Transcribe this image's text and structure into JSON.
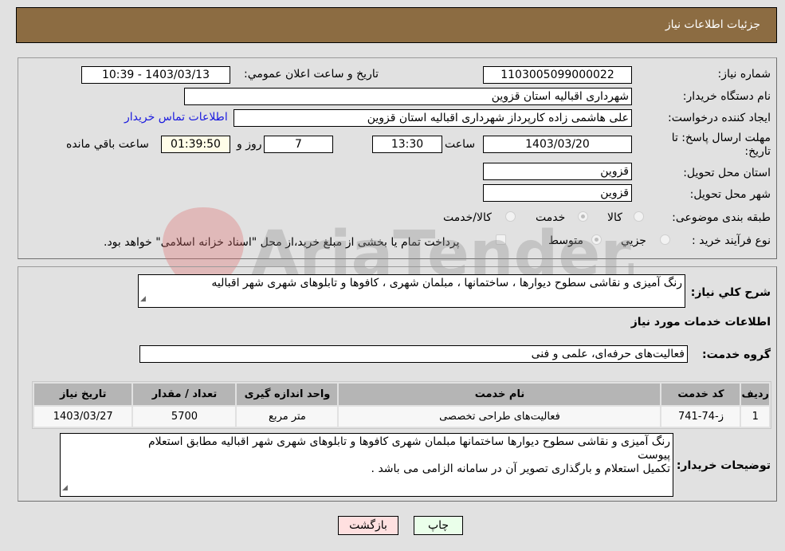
{
  "header": {
    "title": "جزئیات اطلاعات نیاز"
  },
  "fields": {
    "need_number_label": "شماره نیاز:",
    "need_number": "1103005099000022",
    "announce_label": "تاریخ و ساعت اعلان عمومي:",
    "announce_value": "1403/03/13 - 10:39",
    "buyer_org_label": "نام دستگاه خریدار:",
    "buyer_org": "شهرداری اقبالیه استان قزوین",
    "creator_label": "ایجاد کننده درخواست:",
    "creator": "علی هاشمی زاده کارپرداز شهرداری اقبالیه استان قزوین",
    "buyer_contact_link": "اطلاعات تماس خریدار",
    "deadline_label_line1": "مهلت ارسال پاسخ: تا",
    "deadline_label_line2": "تاریخ:",
    "deadline_date": "1403/03/20",
    "time_label": "ساعت",
    "deadline_time": "13:30",
    "days_value": "7",
    "days_label": "روز و",
    "remaining_time": "01:39:50",
    "remaining_label": "ساعت باقي مانده",
    "province_label": "استان محل تحویل:",
    "province": "قزوین",
    "city_label": "شهر محل تحویل:",
    "city": "قزوین",
    "category_label": "طبقه بندی موضوعی:",
    "category_options": [
      "کالا",
      "خدمت",
      "کالا/خدمت"
    ],
    "category_selected": "خدمت",
    "process_label": "نوع فرآیند خرید :",
    "process_options": [
      "جزيي",
      "متوسط"
    ],
    "process_selected": "متوسط",
    "treasury_note": "پرداخت تمام یا بخشی از مبلغ خرید،از محل \"اسناد خزانه اسلامی\" خواهد بود."
  },
  "details": {
    "description_label": "شرح كلي نياز:",
    "description": "رنگ آمیزی و نقاشی سطوح دیوارها ، ساختمانها ، مبلمان شهری ، کافوها و تابلوهای شهری شهر اقبالیه",
    "services_heading": "اطلاعات خدمات مورد نياز",
    "service_group_label": "گروه خدمت:",
    "service_group": "فعالیت‌های حرفه‌ای، علمی و فنی"
  },
  "table": {
    "headers": [
      "ردیف",
      "کد خدمت",
      "نام خدمت",
      "واحد اندازه گیری",
      "تعداد / مقدار",
      "تاریخ نیاز"
    ],
    "rows": [
      [
        "1",
        "ز-74-741",
        "فعالیت‌های طراحی تخصصی",
        "متر مربع",
        "5700",
        "1403/03/27"
      ]
    ]
  },
  "buyer_notes": {
    "label": "توضیحات خریدار:",
    "line1": "رنگ آمیزی و نقاشی سطوح دیوارها ساختمانها مبلمان شهری کافوها و تابلوهای شهری شهر اقبالیه مطابق استعلام",
    "line2": "پیوست",
    "line3": "تکمیل استعلام و بارگذاری تصویر آن در سامانه الزامی می باشد ."
  },
  "buttons": {
    "print": "چاپ",
    "back": "بازگشت"
  },
  "watermark": {
    "text": "AriaTender.neT"
  },
  "colors": {
    "header_bg": "#8c6c42",
    "print_bg": "#eaffea",
    "back_bg": "#ffe0e0",
    "link": "#1a1adf",
    "remaining_bg": "#fffde8"
  }
}
